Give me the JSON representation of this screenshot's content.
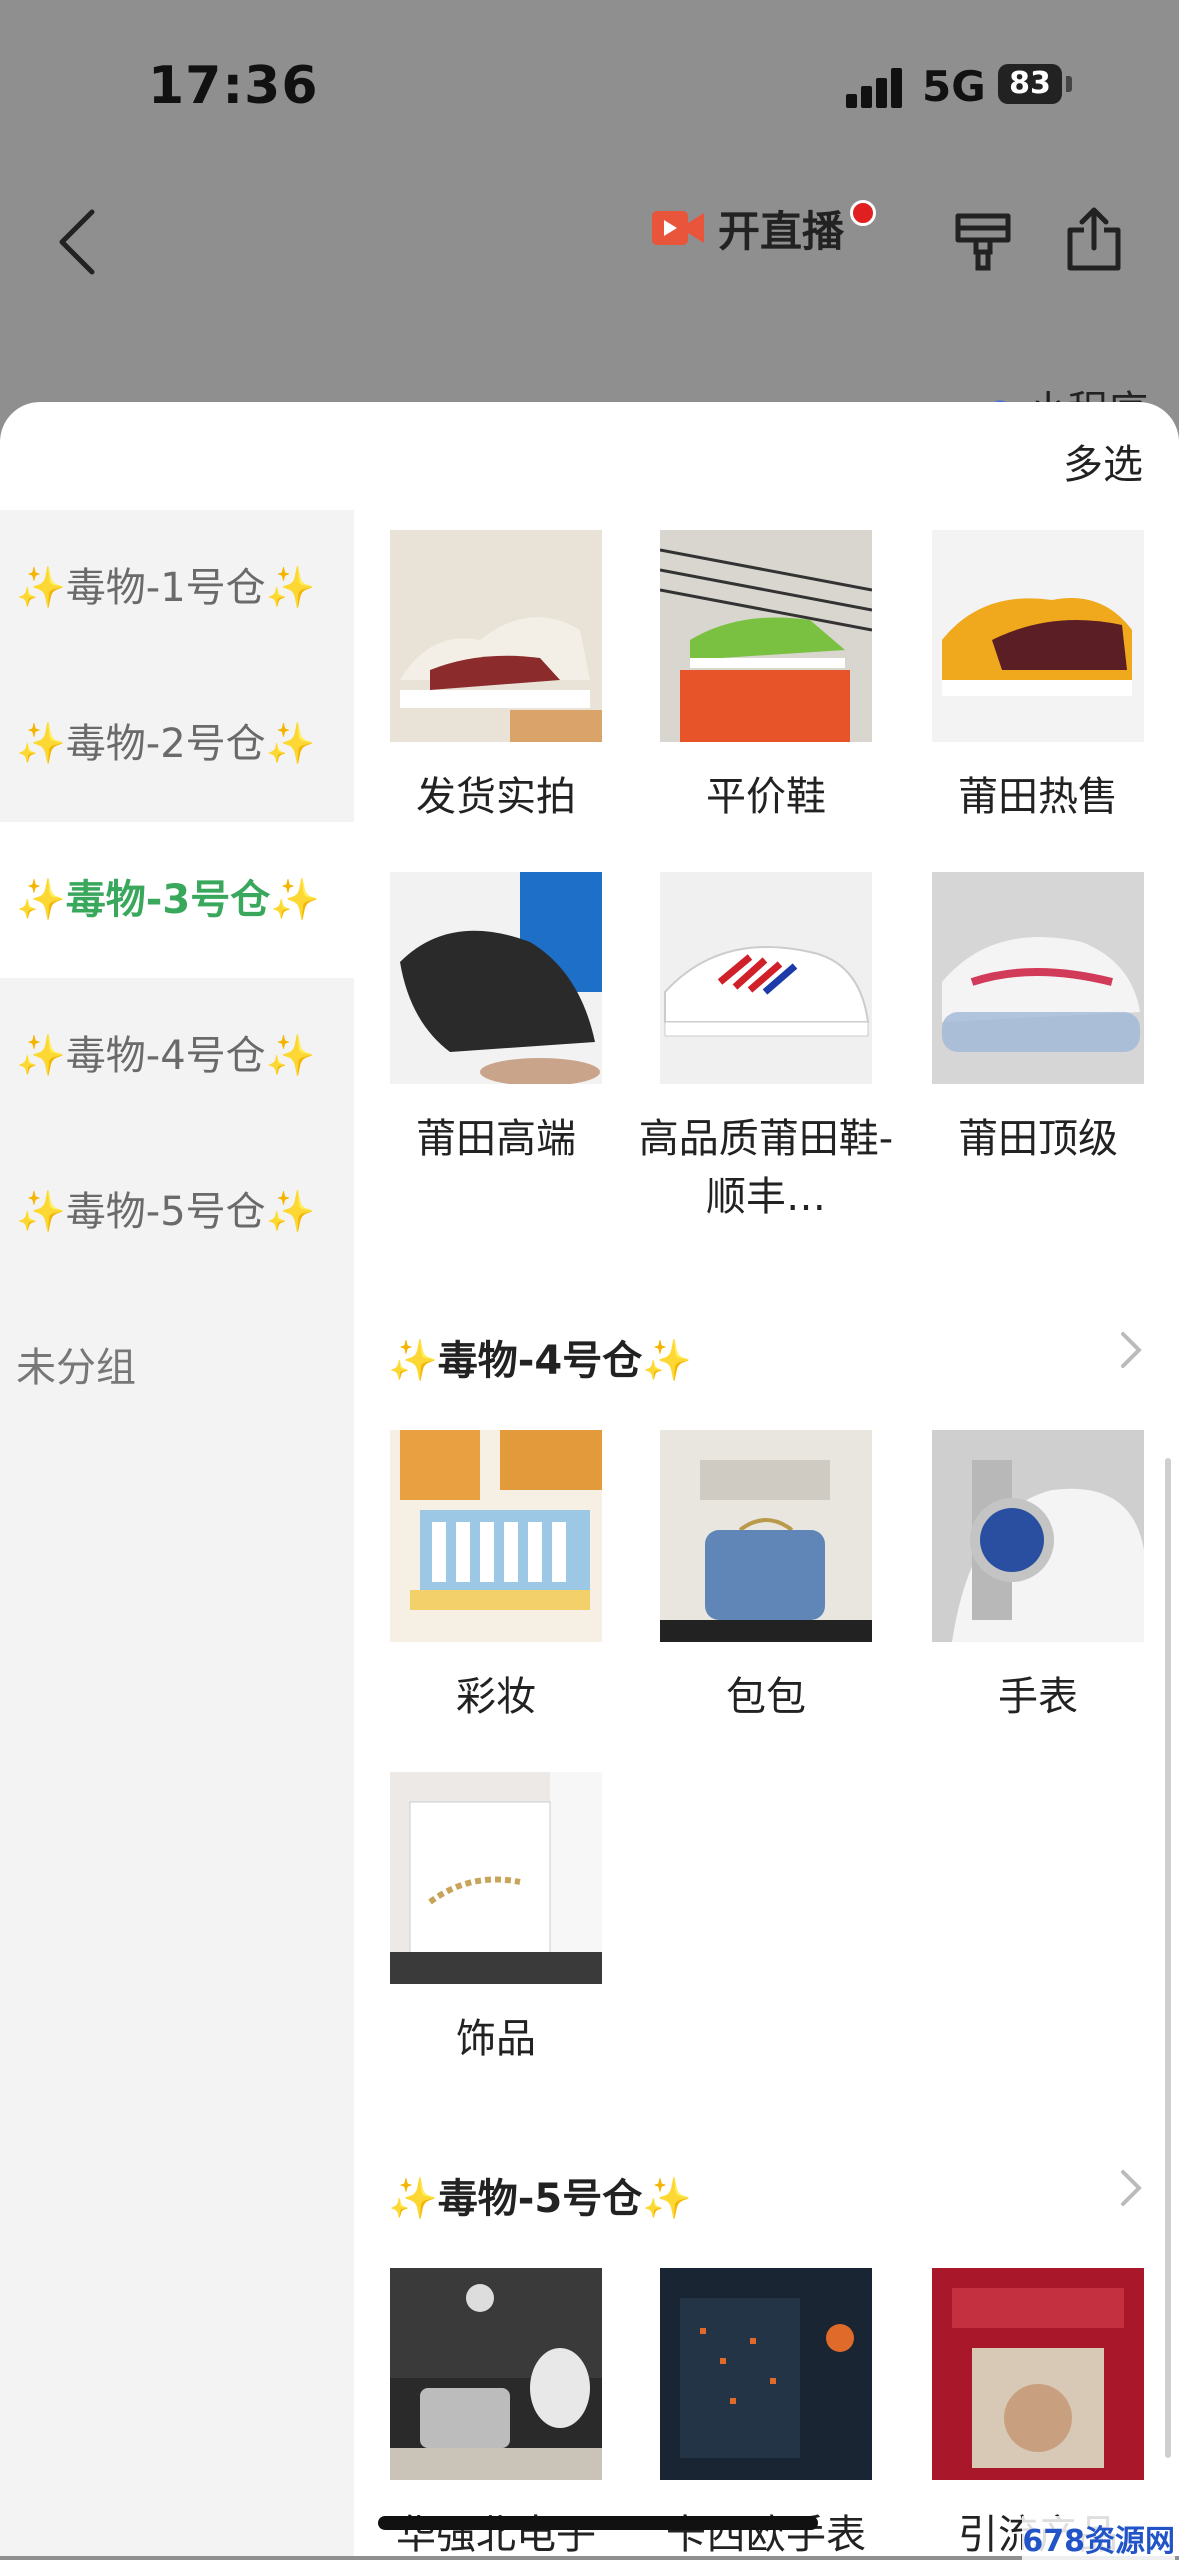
{
  "status": {
    "time": "17:36",
    "network": "5G",
    "battery": "83"
  },
  "header": {
    "live_label": "开直播",
    "mini_program": "小程序"
  },
  "sheet": {
    "multi_select": "多选"
  },
  "sidebar": {
    "items": [
      {
        "label": "✨毒物-1号仓✨"
      },
      {
        "label": "✨毒物-2号仓✨"
      },
      {
        "label": "✨毒物-3号仓✨"
      },
      {
        "label": "✨毒物-4号仓✨"
      },
      {
        "label": "✨毒物-5号仓✨"
      },
      {
        "label": "未分组"
      }
    ]
  },
  "group3": {
    "items": [
      {
        "label": "发货实拍",
        "icon": "sneaker-photo"
      },
      {
        "label": "平价鞋",
        "icon": "sneaker-box-photo"
      },
      {
        "label": "莆田热售",
        "icon": "dunk-photo"
      },
      {
        "label": "莆田高端",
        "icon": "black-sneaker-photo"
      },
      {
        "label": "高品质莆田鞋-顺丰…",
        "icon": "white-sneaker-photo"
      },
      {
        "label": "莆田顶级",
        "icon": "air-sneaker-photo"
      }
    ]
  },
  "group4": {
    "title": "✨毒物-4号仓✨",
    "items": [
      {
        "label": "彩妆",
        "icon": "cosmetics-photo"
      },
      {
        "label": "包包",
        "icon": "bag-photo"
      },
      {
        "label": "手表",
        "icon": "watch-photo"
      },
      {
        "label": "饰品",
        "icon": "jewelry-photo"
      }
    ]
  },
  "group5": {
    "title": "✨毒物-5号仓✨",
    "items": [
      {
        "label": "华强北电子",
        "icon": "electronics-photo"
      },
      {
        "label": "卡西欧手表",
        "icon": "casio-photo"
      },
      {
        "label": "引流产品",
        "icon": "promo-photo"
      }
    ]
  },
  "watermark": "678资源网",
  "colors": {
    "accent": "#3aa85c",
    "sparkle": "#f5c400",
    "live_red": "#e02020"
  }
}
